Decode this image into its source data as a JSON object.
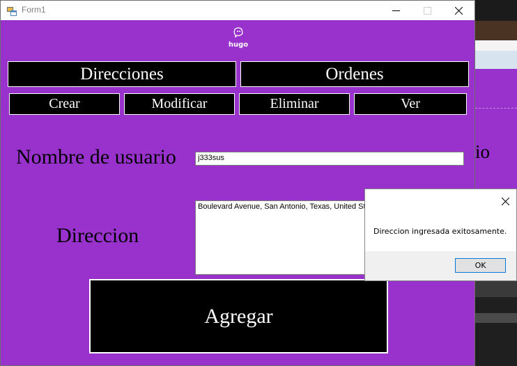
{
  "window": {
    "title": "Form1"
  },
  "logo": {
    "text": "hugo",
    "icon": "hugo-logo-icon"
  },
  "nav": {
    "tabs": [
      "Direcciones",
      "Ordenes"
    ],
    "actions": [
      "Crear",
      "Modificar",
      "Eliminar",
      "Ver"
    ]
  },
  "form": {
    "username_label": "Nombre de usuario",
    "username_value": "j333sus",
    "address_label": "Direccion",
    "address_value": "Boulevard Avenue, San Antonio, Texas, United States",
    "submit_label": "Agregar"
  },
  "messagebox": {
    "message": "Direccion ingresada exitosamente.",
    "ok_label": "OK"
  },
  "background_window": {
    "partial_text": "io"
  },
  "colors": {
    "form_background": "#9932cc",
    "button_background": "#000000",
    "button_text": "#ffffff"
  }
}
